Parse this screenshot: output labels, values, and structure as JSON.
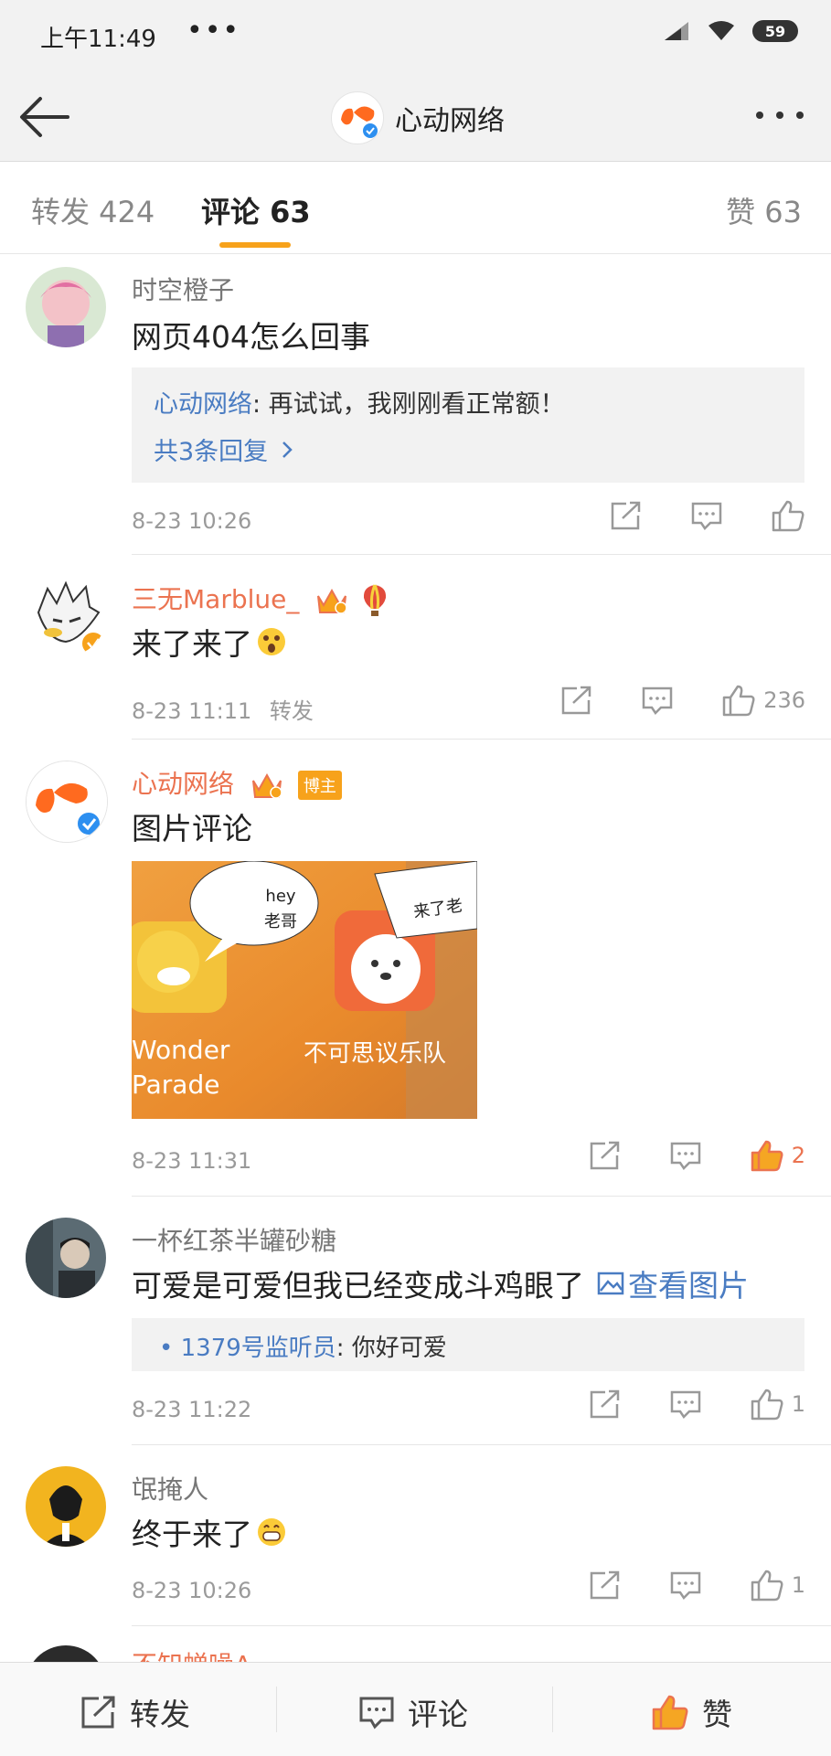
{
  "status_bar": {
    "time": "上午11:49",
    "dots": "•••",
    "battery": "59"
  },
  "nav": {
    "title": "心动网络"
  },
  "tabs": [
    {
      "label": "转发 424"
    },
    {
      "label": "评论 63"
    },
    {
      "label": "赞 63"
    }
  ],
  "comments": [
    {
      "name": "时空橙子",
      "text": "网页404怎么回事",
      "reply_author": "心动网络",
      "reply_text": ": 再试试，我刚刚看正常额！",
      "reply_more": "共3条回复",
      "time": "8-23 10:26"
    },
    {
      "name": "三无Marblue_",
      "text": "来了来了",
      "time": "8-23 11:11",
      "extra": "转发",
      "likes": "236"
    },
    {
      "name": "心动网络",
      "tag": "博主",
      "text": "图片评论",
      "image_texts": {
        "bubble1_line1": "hey",
        "bubble1_line2": "老哥",
        "bubble2": "来了老",
        "caption1_line1": "Wonder",
        "caption1_line2": "Parade",
        "caption2": "不可思议乐队"
      },
      "time": "8-23 11:31",
      "likes": "2"
    },
    {
      "name": "一杯红茶半罐砂糖",
      "text": "可爱是可爱但我已经变成斗鸡眼了",
      "view_image": "查看图片",
      "reply_bullet": "•",
      "reply_author": "1379号监听员",
      "reply_text": ": 你好可爱",
      "time": "8-23 11:22",
      "likes": "1"
    },
    {
      "name": "氓掩人",
      "text": "终于来了",
      "time": "8-23 10:26",
      "likes": "1"
    },
    {
      "name": "不知蝉噪A"
    }
  ],
  "bottom_bar": {
    "repost": "转发",
    "comment": "评论",
    "like": "赞"
  },
  "colors": {
    "accent_orange": "#f7a21b",
    "name_orange": "#eb7350",
    "link_blue": "#4a7cc2",
    "brand_logo": "#ff6a1f"
  }
}
